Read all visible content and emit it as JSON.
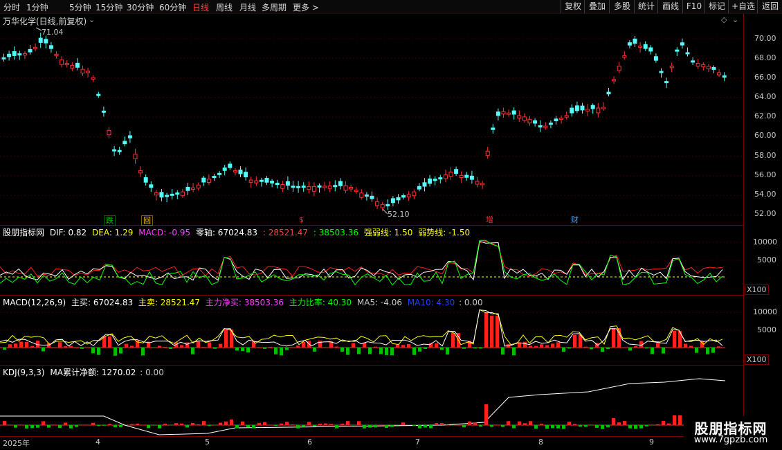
{
  "toolbar": {
    "items": [
      "分时",
      "1分钟",
      "5分钟",
      "15分钟",
      "30分钟",
      "60分钟",
      "日线",
      "周线",
      "月线",
      "多周期",
      "更多 >"
    ],
    "active": "日线",
    "right_buttons": [
      "复权",
      "叠加",
      "多股",
      "统计",
      "画线",
      "F10",
      "标记",
      "+自选",
      "返回"
    ]
  },
  "main": {
    "title": "万华化学(日线,前复权)",
    "high_marker": "71.04",
    "low_marker": "52.10",
    "axis_ticks": [
      "70.00",
      "68.00",
      "66.00",
      "64.00",
      "62.00",
      "60.00",
      "58.00",
      "56.00",
      "54.00",
      "52.00"
    ],
    "event_tags": [
      {
        "text": "跌",
        "color": "#00c000"
      },
      {
        "text": "回",
        "color": "#ffcc00"
      },
      {
        "text": "$",
        "color": "#ff3030"
      },
      {
        "text": "增",
        "color": "#ff3030"
      },
      {
        "text": "财",
        "color": "#40a0ff"
      }
    ],
    "colors": {
      "up": "#ff3232",
      "down": "#54fcfc"
    }
  },
  "panel1": {
    "name": "股朋指标网",
    "items": [
      {
        "text": "DIF: 0.82",
        "color": "#ffffff"
      },
      {
        "text": "DEA: 1.29",
        "color": "#ffff00"
      },
      {
        "text": "MACD: -0.95",
        "color": "#ff40ff"
      },
      {
        "text": "零轴: 67024.83",
        "color": "#ffffff"
      },
      {
        "text": ": 28521.47",
        "color": "#ff4040"
      },
      {
        "text": ": 38503.36",
        "color": "#00ff00"
      },
      {
        "text": "强弱线: 1.50",
        "color": "#ffff00"
      },
      {
        "text": "弱势线: -1.50",
        "color": "#ffff00"
      }
    ],
    "axis_ticks": [
      "10000",
      "5000"
    ],
    "scale": "X100"
  },
  "panel2": {
    "name": "MACD(12,26,9)",
    "items": [
      {
        "text": "主买: 67024.83",
        "color": "#ffffff"
      },
      {
        "text": "主卖: 28521.47",
        "color": "#ffff00"
      },
      {
        "text": "主力净买: 38503.36",
        "color": "#ff40ff"
      },
      {
        "text": "主力比率: 40.30",
        "color": "#00ff00"
      },
      {
        "text": "MA5: -4.06",
        "color": "#c8c8c8"
      },
      {
        "text": "MA10: 4.30",
        "color": "#2040ff"
      },
      {
        "text": ": 0.00",
        "color": "#c8c8c8"
      }
    ],
    "axis_ticks": [
      "10000",
      "5000"
    ],
    "scale": "X100"
  },
  "panel3": {
    "name": "KDJ(9,3,3)",
    "items": [
      {
        "text": "MA累计净额: 1270.02",
        "color": "#ffffff"
      },
      {
        "text": ": 0.00",
        "color": "#c8c8c8"
      }
    ]
  },
  "dates": [
    "2025年",
    "4",
    "5",
    "6",
    "7",
    "8",
    "9"
  ],
  "logo": {
    "title": "股朋指标网",
    "url": "www.7gpzb.com"
  }
}
